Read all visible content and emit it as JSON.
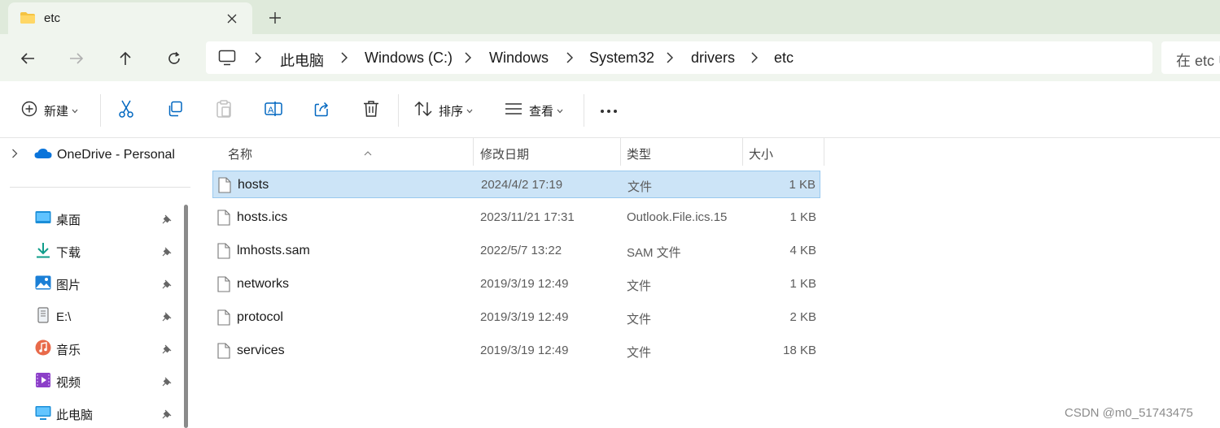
{
  "tab": {
    "title": "etc"
  },
  "breadcrumb": [
    "此电脑",
    "Windows (C:)",
    "Windows",
    "System32",
    "drivers",
    "etc"
  ],
  "search": {
    "placeholder": "在 etc 中"
  },
  "commands": {
    "new_label": "新建",
    "sort_label": "排序",
    "view_label": "查看"
  },
  "sidebar": {
    "onedrive": "OneDrive - Personal",
    "items": [
      {
        "label": "桌面",
        "icon": "desktop-icon"
      },
      {
        "label": "下载",
        "icon": "download-icon"
      },
      {
        "label": "图片",
        "icon": "pictures-icon"
      },
      {
        "label": "E:\\",
        "icon": "drive-icon"
      },
      {
        "label": "音乐",
        "icon": "music-icon"
      },
      {
        "label": "视频",
        "icon": "video-icon"
      },
      {
        "label": "此电脑",
        "icon": "this-pc-icon"
      }
    ]
  },
  "columns": {
    "name": "名称",
    "date": "修改日期",
    "type": "类型",
    "size": "大小"
  },
  "files": [
    {
      "name": "hosts",
      "date": "2024/4/2 17:19",
      "type": "文件",
      "size": "1 KB",
      "selected": true
    },
    {
      "name": "hosts.ics",
      "date": "2023/11/21 17:31",
      "type": "Outlook.File.ics.15",
      "size": "1 KB"
    },
    {
      "name": "lmhosts.sam",
      "date": "2022/5/7 13:22",
      "type": "SAM 文件",
      "size": "4 KB"
    },
    {
      "name": "networks",
      "date": "2019/3/19 12:49",
      "type": "文件",
      "size": "1 KB"
    },
    {
      "name": "protocol",
      "date": "2019/3/19 12:49",
      "type": "文件",
      "size": "2 KB"
    },
    {
      "name": "services",
      "date": "2019/3/19 12:49",
      "type": "文件",
      "size": "18 KB"
    }
  ],
  "watermark": "CSDN @m0_51743475",
  "colors": {
    "selected_row": "#cce4f7",
    "accent": "#0067c0"
  }
}
